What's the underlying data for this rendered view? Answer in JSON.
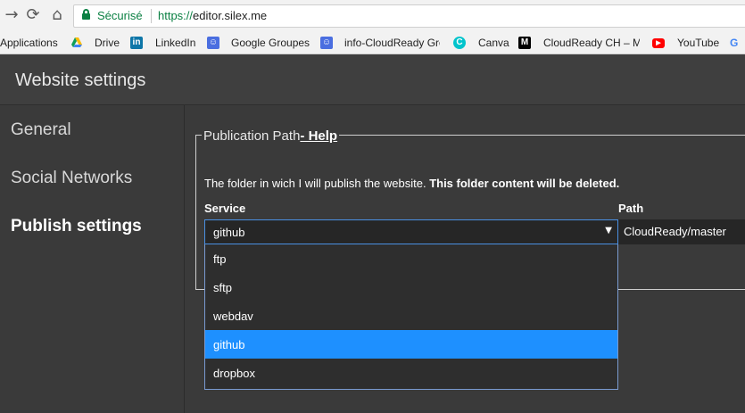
{
  "browser": {
    "secure_label": "Sécurisé",
    "url_protocol": "https://",
    "url_host": "editor.silex.me",
    "bookmarks": [
      {
        "label": "Applications",
        "icon": "apps-icon",
        "color": "#4285f4"
      },
      {
        "label": "Drive",
        "icon": "google-drive-icon",
        "color": "#fbbc05"
      },
      {
        "label": "LinkedIn",
        "icon": "linkedin-icon",
        "color": "#0e76a8"
      },
      {
        "label": "Google Groupes",
        "icon": "google-groups-icon",
        "color": "#4a6ee0"
      },
      {
        "label": "info-CloudReady Grc",
        "icon": "google-groups-icon",
        "color": "#4a6ee0"
      },
      {
        "label": "Canva",
        "icon": "canva-icon",
        "color": "#00c4cc"
      },
      {
        "label": "CloudReady CH – Me",
        "icon": "medium-icon",
        "color": "#000000"
      },
      {
        "label": "YouTube",
        "icon": "youtube-icon",
        "color": "#ff0000"
      },
      {
        "label": "G",
        "icon": "google-icon",
        "color": "#4285f4"
      }
    ]
  },
  "app": {
    "title": "Website settings"
  },
  "sidebar": {
    "items": [
      {
        "label": "General",
        "active": false
      },
      {
        "label": "Social Networks",
        "active": false
      },
      {
        "label": "Publish settings",
        "active": true
      }
    ]
  },
  "publish": {
    "legend": "Publication Path",
    "help_link": "- Help",
    "description": "The folder in wich I will publish the website.",
    "warning": "This folder content will be deleted.",
    "service_label": "Service",
    "path_label": "Path",
    "service_value": "github",
    "path_value": "CloudReady/master",
    "service_options": [
      {
        "label": "ftp",
        "selected": false
      },
      {
        "label": "sftp",
        "selected": false
      },
      {
        "label": "webdav",
        "selected": false
      },
      {
        "label": "github",
        "selected": true
      },
      {
        "label": "dropbox",
        "selected": false
      }
    ]
  },
  "colors": {
    "accent": "#1e90ff",
    "secure_green": "#0b8043",
    "app_bg": "#3a3a3a"
  }
}
